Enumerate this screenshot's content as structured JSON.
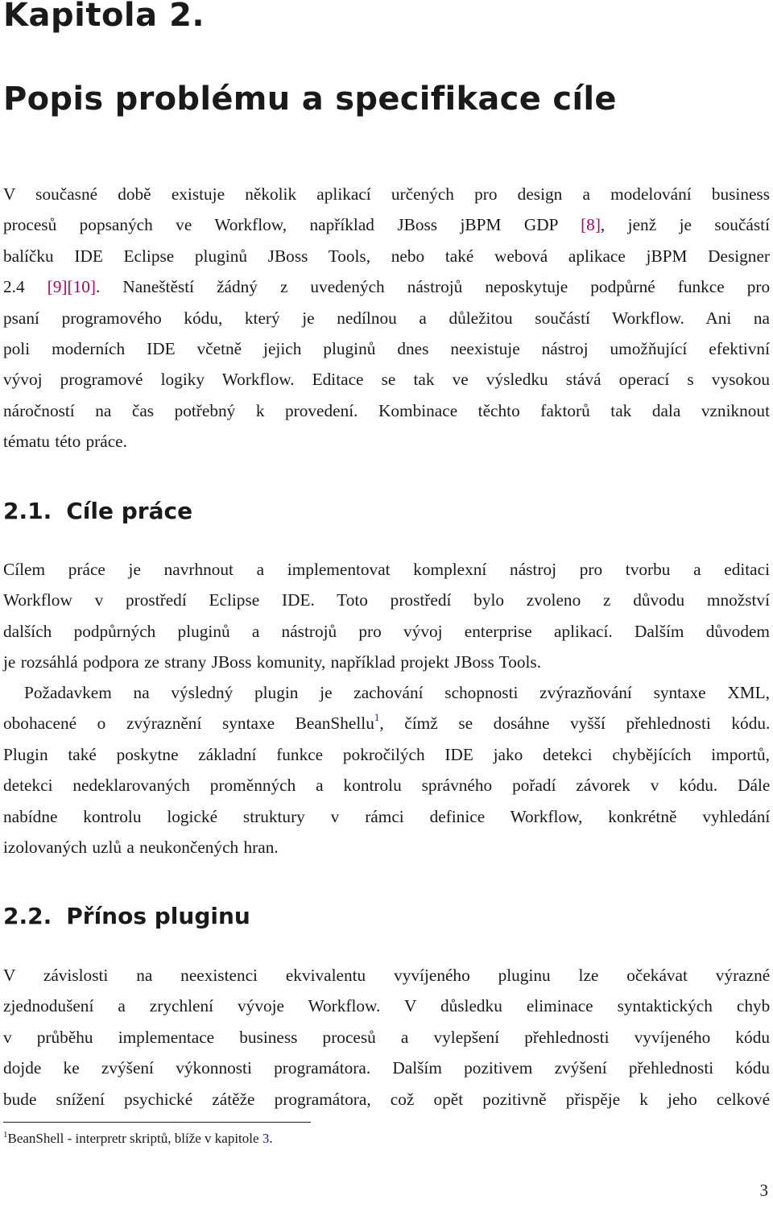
{
  "chapter": {
    "label": "Kapitola 2.",
    "title": "Popis problému a specifikace cíle"
  },
  "intro": {
    "lines": [
      [
        "V současné době existuje několik aplikací určených pro design a modelování business"
      ],
      [
        "procesů popsaných ve Workflow, například JBoss jBPM GDP ",
        "[8]",
        ", jenž je součástí"
      ],
      [
        "balíčku IDE Eclipse pluginů JBoss Tools, nebo také webová aplikace jBPM Designer"
      ],
      [
        "2.4 ",
        "[9][10]",
        ". Naneštěstí žádný z uvedených nástrojů neposkytuje podpůrné funkce pro"
      ],
      [
        "psaní programového kódu, který je nedílnou a důležitou součástí Workflow. Ani na"
      ],
      [
        "poli moderních IDE včetně jejich pluginů dnes neexistuje nástroj umožňující efektivní"
      ],
      [
        "vývoj programové logiky Workflow. Editace se tak ve výsledku stává operací s vysokou"
      ],
      [
        "náročností na čas potřebný k provedení. Kombinace těchto faktorů tak dala vzniknout"
      ],
      [
        "tématu této práce."
      ]
    ],
    "citations": {
      "c8": "[8]",
      "c9_10": "[9][10]"
    },
    "line_text": {
      "l1": "V současné době existuje několik aplikací určených pro design a modelování business",
      "l2a": "procesů popsaných ve Workflow, například JBoss jBPM GDP ",
      "l2b": ", jenž je součástí",
      "l3": "balíčku IDE Eclipse pluginů JBoss Tools, nebo také webová aplikace jBPM Designer",
      "l4a": "2.4 ",
      "l4b": ". Naneštěstí žádný z uvedených nástrojů neposkytuje podpůrné funkce pro",
      "l5": "psaní programového kódu, který je nedílnou a důležitou součástí Workflow. Ani na",
      "l6": "poli moderních IDE včetně jejich pluginů dnes neexistuje nástroj umožňující efektivní",
      "l7": "vývoj programové logiky Workflow. Editace se tak ve výsledku stává operací s vysokou",
      "l8": "náročností na čas potřebný k provedení. Kombinace těchto faktorů tak dala vzniknout",
      "l9": "tématu této práce."
    }
  },
  "section_2_1": {
    "number": "2.1.",
    "title": "Cíle práce",
    "p1": {
      "l1": "Cílem práce je navrhnout a implementovat komplexní nástroj pro tvorbu a editaci",
      "l2": "Workflow v prostředí Eclipse IDE. Toto prostředí bylo zvoleno z důvodu množství",
      "l3": "dalších podpůrných pluginů a nástrojů pro vývoj enterprise aplikací. Dalším důvodem",
      "l4": "je rozsáhlá podpora ze strany JBoss komunity, například projekt JBoss Tools."
    },
    "p2": {
      "l1": "Požadavkem na výsledný plugin je zachování schopnosti zvýrazňování syntaxe XML,",
      "l2a": "obohacené o zvýraznění syntaxe BeanShellu",
      "l2_fn": "1",
      "l2b": ", čímž se dosáhne vyšší přehlednosti kódu.",
      "l3": "Plugin také poskytne základní funkce pokročilých IDE jako detekci chybějících importů,",
      "l4": "detekci nedeklarovaných proměnných a kontrolu správného pořadí závorek v kódu. Dále",
      "l5": "nabídne kontrolu logické struktury v rámci definice Workflow, konkrétně vyhledání",
      "l6": "izolovaných uzlů a neukončených hran."
    }
  },
  "section_2_2": {
    "number": "2.2.",
    "title": "Přínos pluginu",
    "p1": {
      "l1": "V závislosti na neexistenci ekvivalentu vyvíjeného pluginu lze očekávat výrazné",
      "l2": "zjednodušení a zrychlení vývoje Workflow. V důsledku eliminace syntaktických chyb",
      "l3": "v průběhu implementace business procesů a vylepšení přehlednosti vyvíjeného kódu",
      "l4": "dojde ke zvýšení výkonnosti programátora. Dalším pozitivem zvýšení přehlednosti kódu",
      "l5": "bude snížení psychické zátěže programátora, což opět pozitivně přispěje k jeho celkové"
    }
  },
  "footnote": {
    "mark": "1",
    "text": "BeanShell - interpretr skriptů, blíže v kapitole ",
    "ref": "3",
    "end": "."
  },
  "page_number": "3",
  "colors": {
    "citation": "#b3006b",
    "reference": "#1a1aa6",
    "text": "#1a1a1a"
  }
}
